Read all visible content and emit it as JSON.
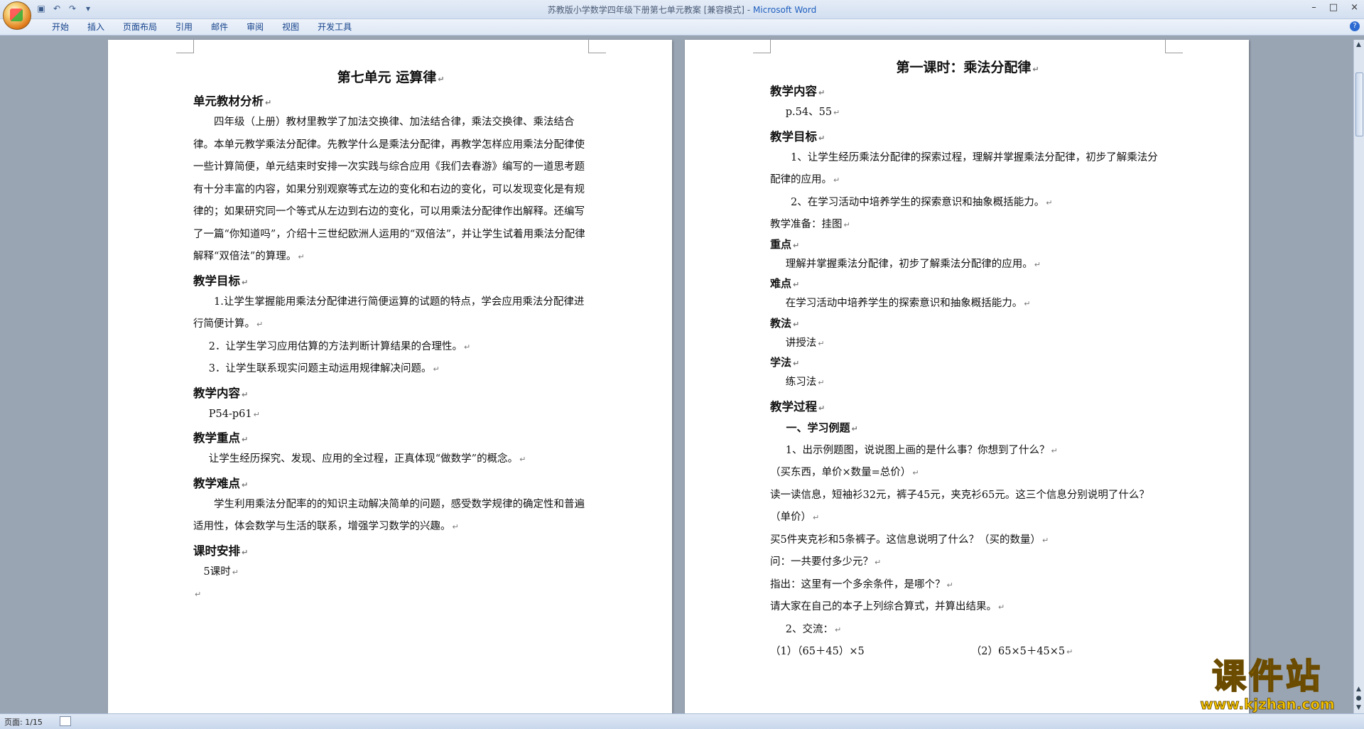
{
  "window": {
    "title": "苏教版小学数学四年级下册第七单元教案 [兼容模式] - ",
    "app": "Microsoft Word",
    "controls": [
      "–",
      "□",
      "×"
    ]
  },
  "ribbon": {
    "tabs": [
      "开始",
      "插入",
      "页面布局",
      "引用",
      "邮件",
      "审阅",
      "视图",
      "开发工具"
    ]
  },
  "left_page": {
    "title": "第七单元  运算律",
    "sec1": "单元教材分析",
    "para1": "四年级（上册）教材里教学了加法交换律、加法结合律，乘法交换律、乘法结合律。本单元教学乘法分配律。先教学什么是乘法分配律，再教学怎样应用乘法分配律使一些计算简便，单元结束时安排一次实践与综合应用《我们去春游》编写的一道思考题有十分丰富的内容，如果分别观察等式左边的变化和右边的变化，可以发现变化是有规律的；如果研究同一个等式从左边到右边的变化，可以用乘法分配律作出解释。还编写了一篇“你知道吗”，介绍十三世纪欧洲人运用的“双倍法”，并让学生试着用乘法分配律解释“双倍法”的算理。",
    "sec2": "教学目标",
    "goal1": "1.让学生掌握能用乘法分配律进行简便运算的试题的特点，学会应用乘法分配律进行简便计算。",
    "goal2": "2．让学生学习应用估算的方法判断计算结果的合理性。",
    "goal3": "3．让学生联系现实问题主动运用规律解决问题。",
    "sec3": "教学内容",
    "content": "P54-p61",
    "sec4": "教学重点",
    "key": "让学生经历探究、发现、应用的全过程，正真体现“做数学”的概念。",
    "sec5": "教学难点",
    "difficulty": "学生利用乘法分配率的的知识主动解决简单的问题，感受数学规律的确定性和普遍适用性，体会数学与生活的联系，增强学习数学的兴趣。",
    "sec6": "课时安排",
    "hours": "5课时"
  },
  "right_page": {
    "title": "第一课时：乘法分配律",
    "sec1": "教学内容",
    "pages": "p.54、55",
    "sec2": "教学目标",
    "goal1": "1、让学生经历乘法分配律的探索过程，理解并掌握乘法分配律，初步了解乘法分配律的应用。",
    "goal2": "2、在学习活动中培养学生的探索意识和抽象概括能力。",
    "prep": "教学准备：挂图",
    "key_label": "重点",
    "key": "理解并掌握乘法分配律，初步了解乘法分配律的应用。",
    "diff_label": "难点",
    "diff": "在学习活动中培养学生的探索意识和抽象概括能力。",
    "teach_label": "教法",
    "teach": "讲授法",
    "learn_label": "学法",
    "learn": "练习法",
    "sec3": "教学过程",
    "step1": "一、学习例题",
    "s1": "1、出示例题图，说说图上画的是什么事？你想到了什么？",
    "s2": "（买东西，单价×数量=总价）",
    "s3": "读一读信息，短袖衫32元，裤子45元，夹克衫65元。这三个信息分别说明了什么？（单价）",
    "s4": "买5件夹克衫和5条裤子。这信息说明了什么？（买的数量）",
    "s5": "问：一共要付多少元？",
    "s6": "指出：这里有一个多余条件，是哪个？",
    "s7": "请大家在自己的本子上列综合算式，并算出结果。",
    "s8": "2、交流：",
    "eq1": "（1）（65＋45）×5",
    "eq2": "（2）65×5＋45×5"
  },
  "status": {
    "page": "页面: 1/15"
  },
  "watermark": {
    "big": "课件站",
    "url": "www.kjzhan.com"
  }
}
